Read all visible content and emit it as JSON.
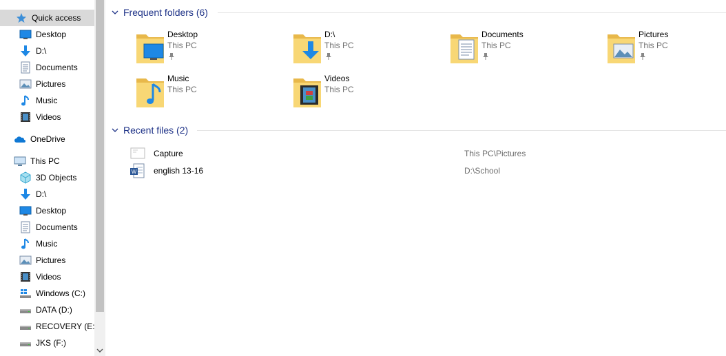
{
  "nav": {
    "quick_access": "Quick access",
    "quick_items": [
      {
        "label": "Desktop",
        "icon": "desktop-icon",
        "pinned": true
      },
      {
        "label": "D:\\",
        "icon": "download-arrow-icon",
        "pinned": true
      },
      {
        "label": "Documents",
        "icon": "documents-icon",
        "pinned": true
      },
      {
        "label": "Pictures",
        "icon": "pictures-icon",
        "pinned": true
      },
      {
        "label": "Music",
        "icon": "music-icon",
        "pinned": false
      },
      {
        "label": "Videos",
        "icon": "videos-icon",
        "pinned": false
      }
    ],
    "onedrive": "OneDrive",
    "this_pc": "This PC",
    "pc_items": [
      {
        "label": "3D Objects",
        "icon": "3d-objects-icon"
      },
      {
        "label": "D:\\",
        "icon": "download-arrow-icon"
      },
      {
        "label": "Desktop",
        "icon": "desktop-icon"
      },
      {
        "label": "Documents",
        "icon": "documents-icon"
      },
      {
        "label": "Music",
        "icon": "music-icon"
      },
      {
        "label": "Pictures",
        "icon": "pictures-icon"
      },
      {
        "label": "Videos",
        "icon": "videos-icon"
      },
      {
        "label": "Windows (C:)",
        "icon": "windows-drive-icon"
      },
      {
        "label": "DATA (D:)",
        "icon": "drive-icon"
      },
      {
        "label": "RECOVERY (E:)",
        "icon": "drive-icon"
      },
      {
        "label": "JKS (F:)",
        "icon": "drive-icon"
      }
    ]
  },
  "content": {
    "frequent_header": "Frequent folders (6)",
    "folders": [
      {
        "name": "Desktop",
        "location": "This PC",
        "pinned": true,
        "icon": "desktop-folder-icon"
      },
      {
        "name": "D:\\",
        "location": "This PC",
        "pinned": true,
        "icon": "download-folder-icon"
      },
      {
        "name": "Documents",
        "location": "This PC",
        "pinned": true,
        "icon": "documents-folder-icon"
      },
      {
        "name": "Pictures",
        "location": "This PC",
        "pinned": true,
        "icon": "pictures-folder-icon"
      },
      {
        "name": "Music",
        "location": "This PC",
        "pinned": false,
        "icon": "music-folder-icon"
      },
      {
        "name": "Videos",
        "location": "This PC",
        "pinned": false,
        "icon": "videos-folder-icon"
      }
    ],
    "recent_header": "Recent files (2)",
    "files": [
      {
        "name": "Capture",
        "path": "This PC\\Pictures",
        "icon": "image-file-icon"
      },
      {
        "name": "english 13-16",
        "path": "D:\\School",
        "icon": "word-document-icon"
      }
    ]
  },
  "colors": {
    "header_text": "#1e3287",
    "selection": "#cce8ff",
    "folder_yellow": "#f8d775",
    "accent_blue": "#1e88e5"
  }
}
